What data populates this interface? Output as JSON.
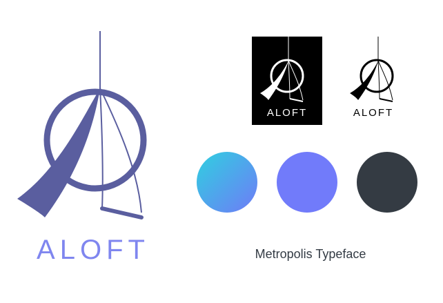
{
  "brand": {
    "wordmark": "ALOFT",
    "primary_color": "#5a5e9f",
    "wordmark_color": "#7f86ef"
  },
  "logo_variants": [
    {
      "style": "white-on-black",
      "label": "ALOFT",
      "background": "#000000",
      "foreground": "#ffffff"
    },
    {
      "style": "black-on-white",
      "label": "ALOFT",
      "background": "#ffffff",
      "foreground": "#000000"
    }
  ],
  "palette": [
    {
      "type": "gradient",
      "from": "#2fd0e0",
      "to": "#6f7bf7"
    },
    {
      "type": "solid",
      "color": "#717bfa"
    },
    {
      "type": "solid",
      "color": "#343b43"
    }
  ],
  "typeface": {
    "label": "Metropolis Typeface"
  }
}
